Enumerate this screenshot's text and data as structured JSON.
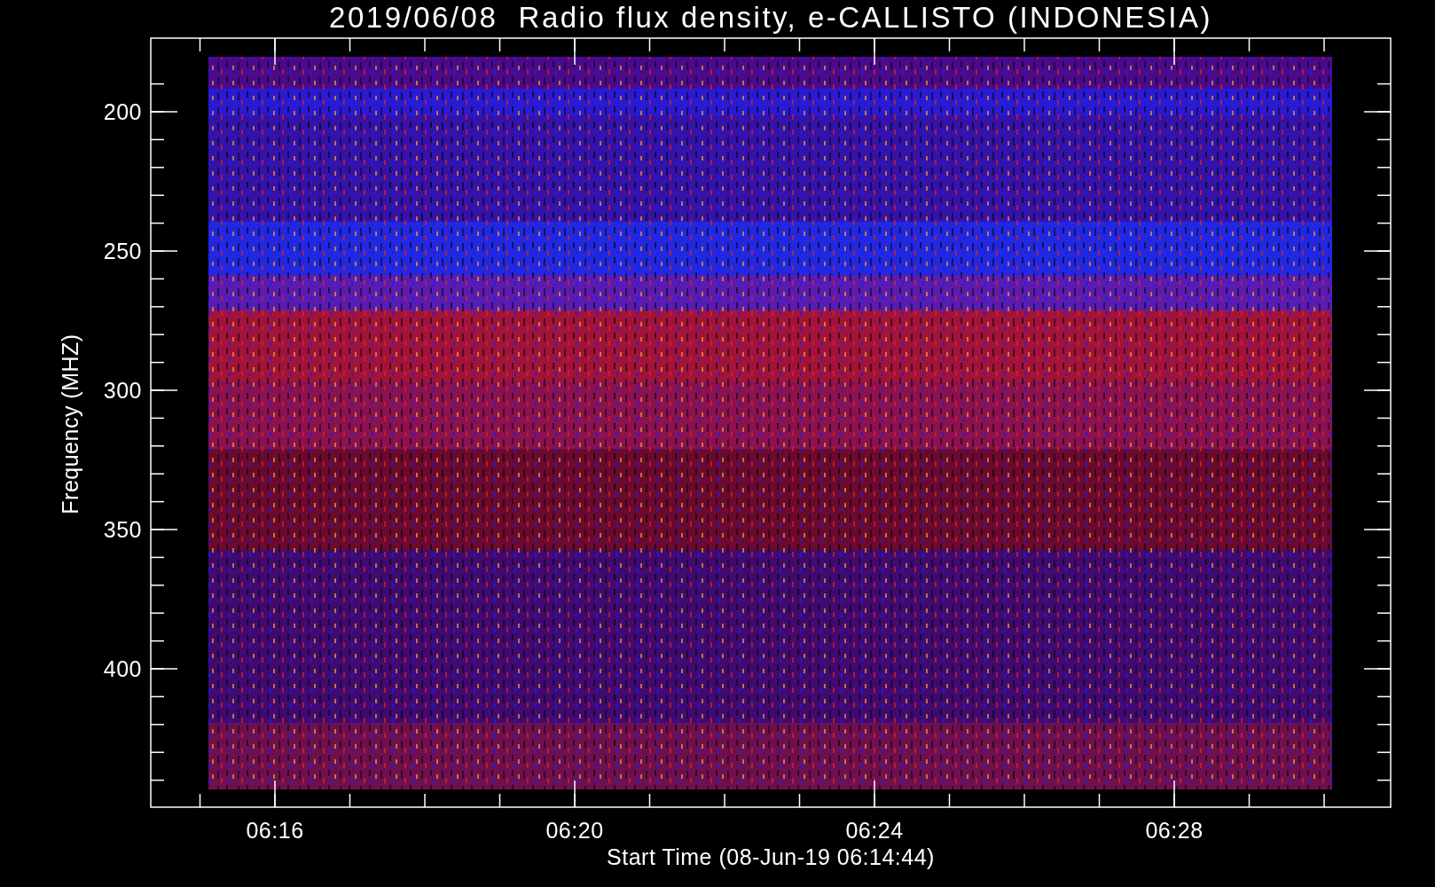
{
  "title": "2019/06/08  Radio flux density, e-CALLISTO (INDONESIA)",
  "ylabel": "Frequency (MHZ)",
  "xlabel": "Start Time (08-Jun-19 06:14:44)",
  "yticks": [
    "200",
    "250",
    "300",
    "350",
    "400"
  ],
  "xticks": [
    "06:16",
    "06:20",
    "06:24",
    "06:28"
  ]
}
